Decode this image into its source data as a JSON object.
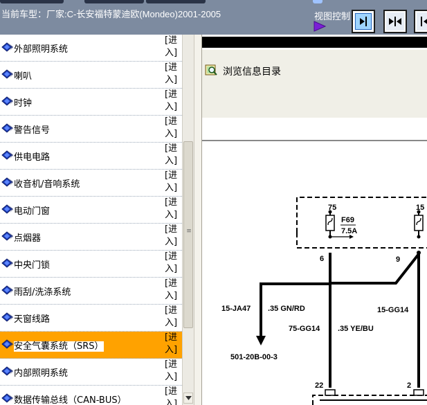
{
  "header": {
    "vehicle_line": "当前车型：厂家:C-长安福特蒙迪欧(Mondeo)2001-2005",
    "view_control_label": "视图控制",
    "colors": {
      "bar": "#7d8ba0",
      "text": "#ffffff"
    },
    "view_buttons": [
      {
        "icon": "align-right-icon"
      },
      {
        "icon": "center-collapse-icon"
      },
      {
        "icon": "align-left-icon"
      }
    ]
  },
  "left_list": {
    "enter_label": "[进入]",
    "highlight_color": "#ffa200",
    "items": [
      {
        "label": "外部照明系统"
      },
      {
        "label": "喇叭"
      },
      {
        "label": "时钟"
      },
      {
        "label": "警告信号"
      },
      {
        "label": "供电电路"
      },
      {
        "label": "收音机/音响系统"
      },
      {
        "label": "电动门窗"
      },
      {
        "label": "点烟器"
      },
      {
        "label": "中央门锁"
      },
      {
        "label": "雨刮/洗涤系统"
      },
      {
        "label": "天窗线路"
      },
      {
        "label": "安全气囊系统（SRS）",
        "selected": true
      },
      {
        "label": "内部照明系统"
      },
      {
        "label": "数据传输总线（CAN-BUS）"
      }
    ]
  },
  "right_panel": {
    "browse_label": "浏览信息目录",
    "diagram": {
      "fuse_label": "F69",
      "fuse_rating": "7.5A",
      "pin_75": "75",
      "pin_15": "15",
      "pin_6": "6",
      "pin_9": "9",
      "wire_left_code": "15-JA47",
      "wire_left_color": ".35 GN/RD",
      "wire_mid_code": "75-GG14",
      "wire_mid_color": ".35 YE/BU",
      "wire_right_code": "15-GG14",
      "ref_label": "501-20B-00-3",
      "pin_22": "22",
      "pin_2": "2"
    }
  }
}
